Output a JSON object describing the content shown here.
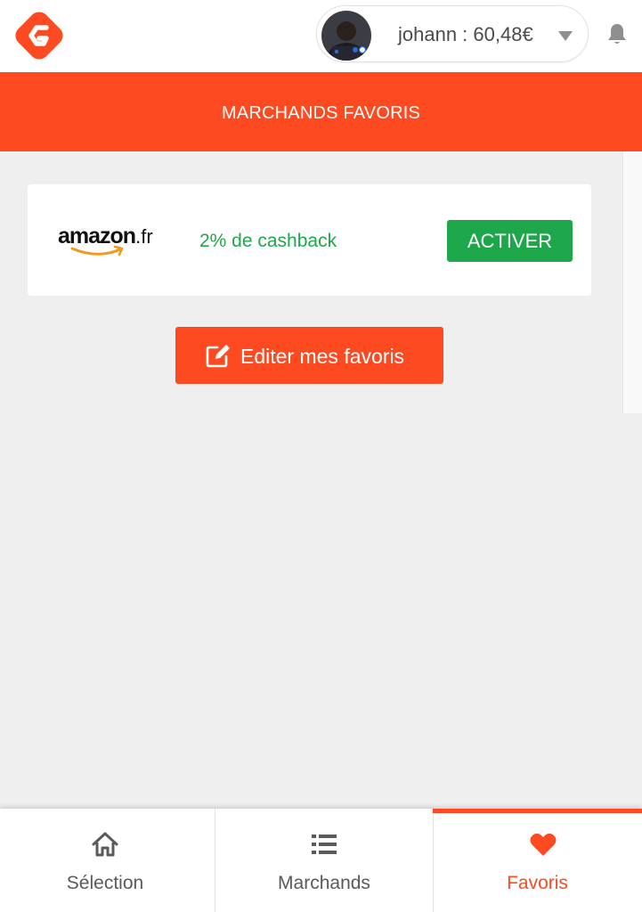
{
  "header": {
    "logo_icon": "cashback-logo-icon",
    "user": {
      "avatar_icon": "user-avatar",
      "label": "johann : 60,48€",
      "dropdown_icon": "caret-down-icon"
    },
    "notification_icon": "bell-icon"
  },
  "page": {
    "title": "MARCHANDS FAVORIS"
  },
  "favorites": [
    {
      "merchant_name": "amazon",
      "merchant_tld": ".fr",
      "cashback": "2% de cashback",
      "action_label": "ACTIVER"
    }
  ],
  "edit_button": {
    "icon": "edit-icon",
    "label": "Editer mes favoris"
  },
  "bottom_nav": {
    "items": [
      {
        "label": "Sélection",
        "icon": "home-icon",
        "active": false
      },
      {
        "label": "Marchands",
        "icon": "list-icon",
        "active": false
      },
      {
        "label": "Favoris",
        "icon": "heart-icon",
        "active": true
      }
    ]
  },
  "colors": {
    "accent": "#fd4a20",
    "success": "#1da64a",
    "background": "#efefef"
  }
}
